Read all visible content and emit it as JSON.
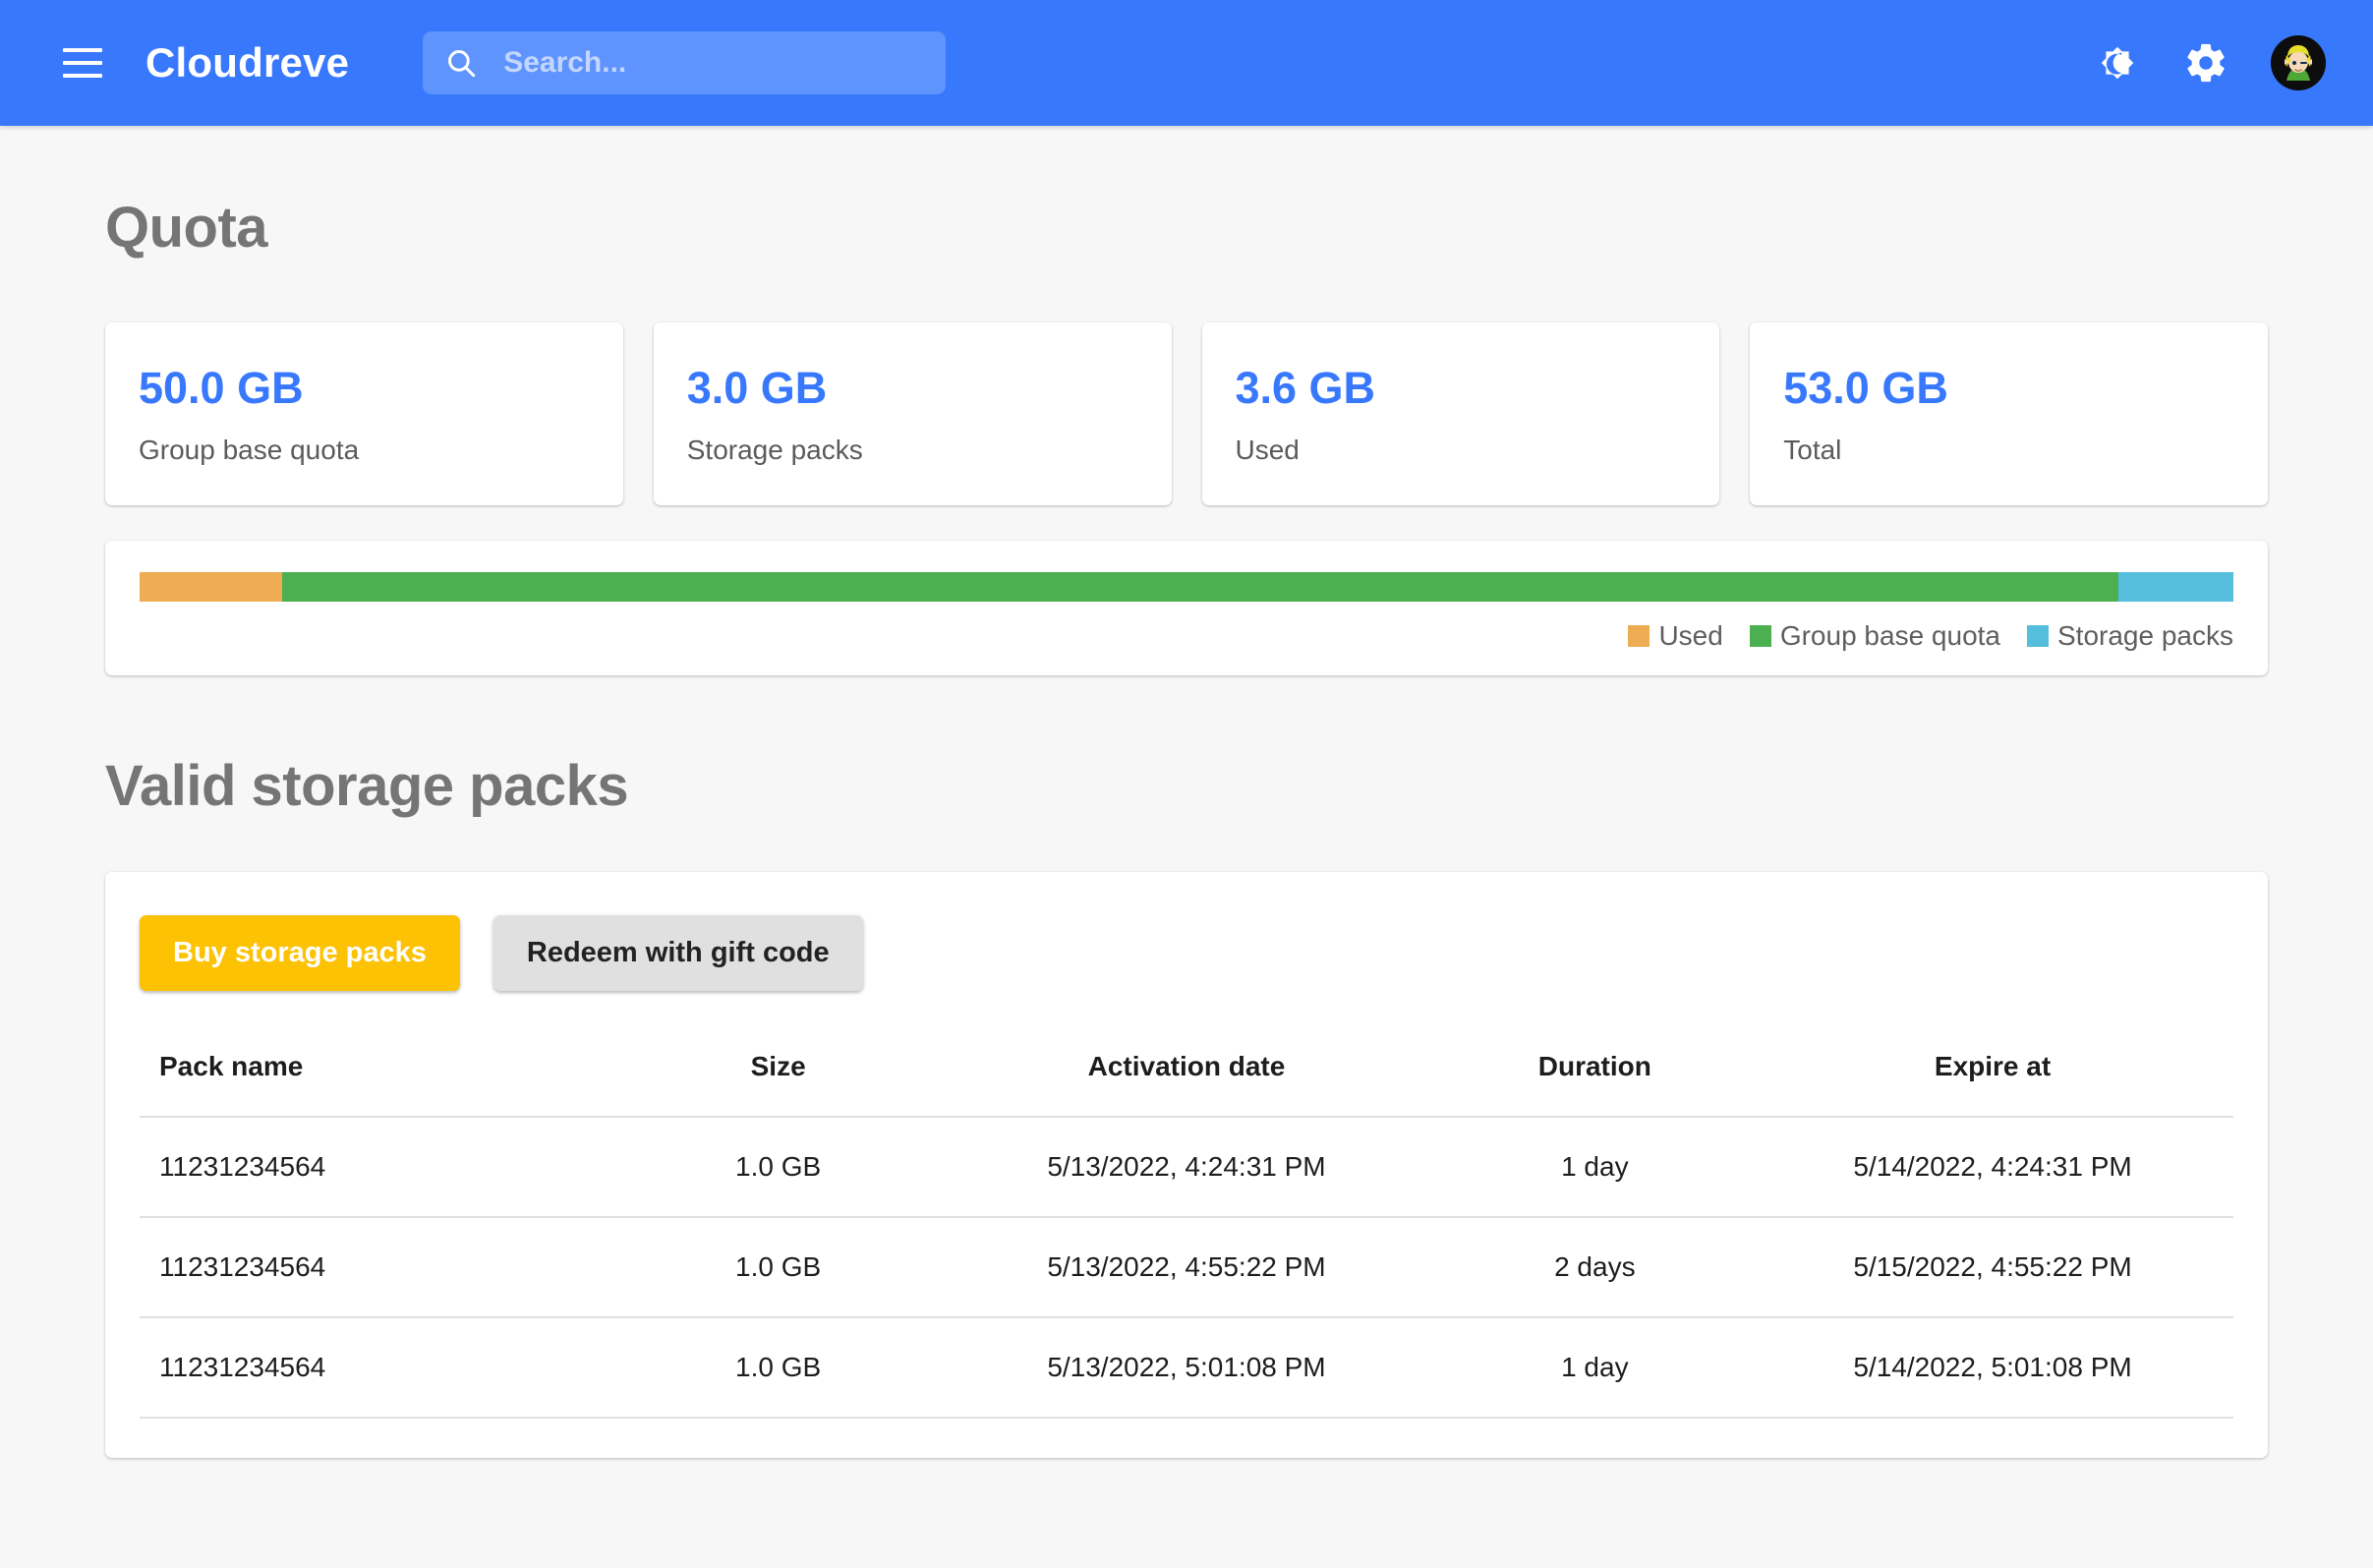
{
  "header": {
    "brand": "Cloudreve",
    "menu_icon": "hamburger-icon",
    "search": {
      "placeholder": "Search...",
      "value": "",
      "icon": "search-icon"
    },
    "actions": [
      {
        "name": "dark-mode-toggle",
        "icon": "brightness-moon-icon"
      },
      {
        "name": "settings-button",
        "icon": "gear-icon"
      },
      {
        "name": "user-avatar",
        "icon": "avatar-icon"
      }
    ],
    "colors": {
      "background": "#3878fd",
      "text": "#ffffff"
    }
  },
  "quota": {
    "title": "Quota",
    "cards": [
      {
        "value": "50.0 GB",
        "label": "Group base quota"
      },
      {
        "value": "3.0 GB",
        "label": "Storage packs"
      },
      {
        "value": "3.6 GB",
        "label": "Used"
      },
      {
        "value": "53.0 GB",
        "label": "Total"
      }
    ],
    "value_color": "#3878fd"
  },
  "usage_bar": {
    "segments": [
      {
        "label": "Used",
        "color": "#eeac53",
        "percent": 6.8
      },
      {
        "label": "Group base quota",
        "color": "#4caf50",
        "percent": 87.7
      },
      {
        "label": "Storage packs",
        "color": "#55bedd",
        "percent": 5.5
      }
    ],
    "legend": [
      {
        "label": "Used",
        "color": "#eeac53"
      },
      {
        "label": "Group base quota",
        "color": "#4caf50"
      },
      {
        "label": "Storage packs",
        "color": "#55bedd"
      }
    ]
  },
  "packs": {
    "title": "Valid storage packs",
    "buttons": {
      "buy": "Buy storage packs",
      "redeem": "Redeem with gift code"
    },
    "button_colors": {
      "buy_bg": "#fcc203",
      "redeem_bg": "#e0e0e0"
    },
    "table": {
      "columns": [
        "Pack name",
        "Size",
        "Activation date",
        "Duration",
        "Expire at"
      ],
      "rows": [
        {
          "name": "11231234564",
          "size": "1.0 GB",
          "activation": "5/13/2022, 4:24:31 PM",
          "duration": "1 day",
          "expire": "5/14/2022, 4:24:31 PM"
        },
        {
          "name": "11231234564",
          "size": "1.0 GB",
          "activation": "5/13/2022, 4:55:22 PM",
          "duration": "2 days",
          "expire": "5/15/2022, 4:55:22 PM"
        },
        {
          "name": "11231234564",
          "size": "1.0 GB",
          "activation": "5/13/2022, 5:01:08 PM",
          "duration": "1 day",
          "expire": "5/14/2022, 5:01:08 PM"
        }
      ]
    }
  }
}
